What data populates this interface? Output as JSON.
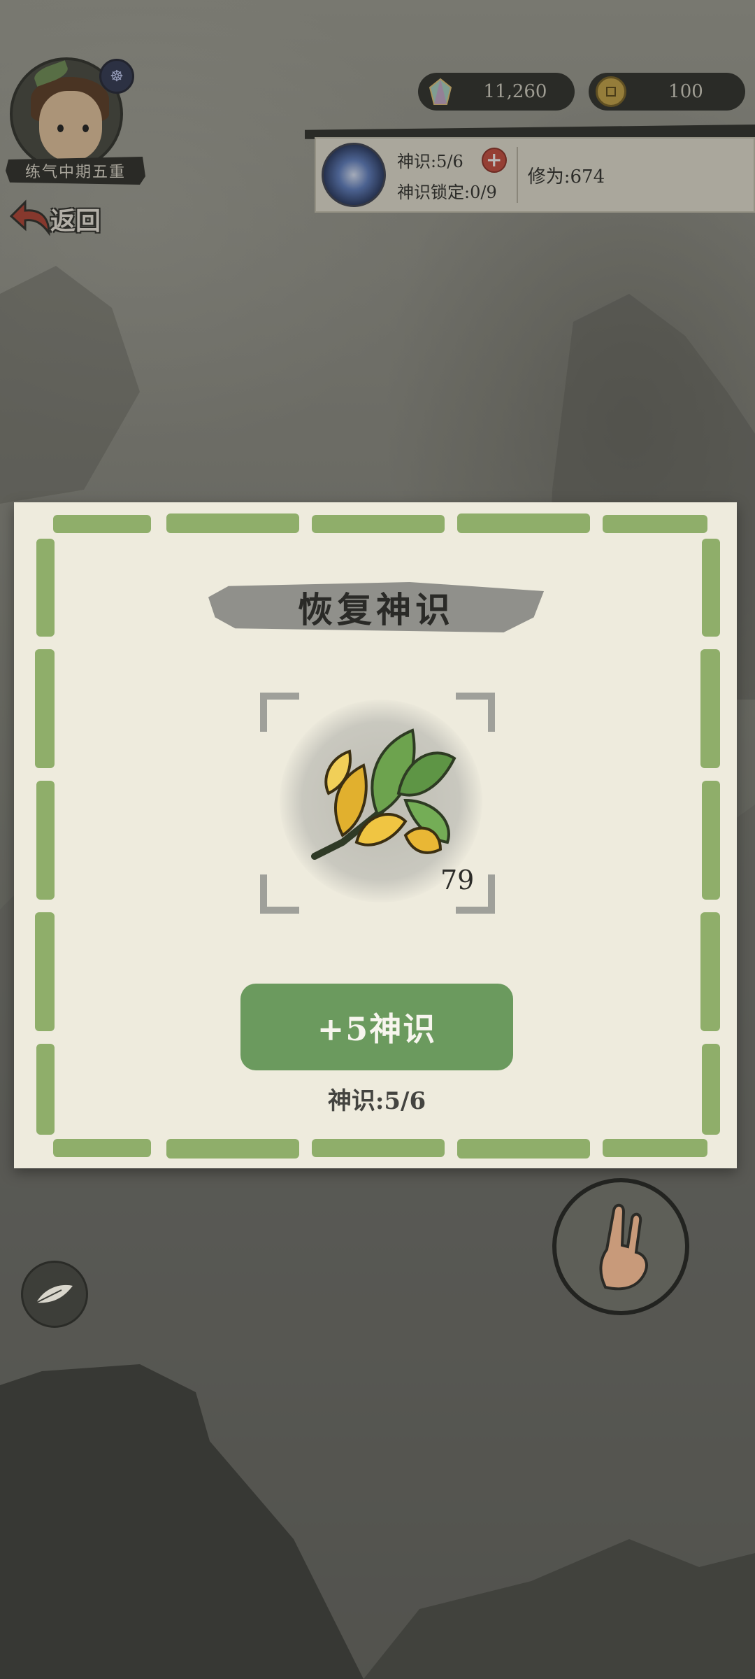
{
  "player": {
    "rank": "练气中期五重",
    "back_label": "返回"
  },
  "currency": {
    "gems": "11,260",
    "coins": "100"
  },
  "status": {
    "spirit_sense": "神识:5/6",
    "spirit_lock": "神识锁定:0/9",
    "cultivation": "修为:674",
    "plus_symbol": "+"
  },
  "modal": {
    "title": "恢复神识",
    "item_quantity": "79",
    "use_button_label": "+5神识",
    "current_sense": "神识:5/6"
  },
  "colors": {
    "border_green": "#8fae6a",
    "button_green": "#6b9a5e",
    "plus_red": "#c94a3c"
  }
}
